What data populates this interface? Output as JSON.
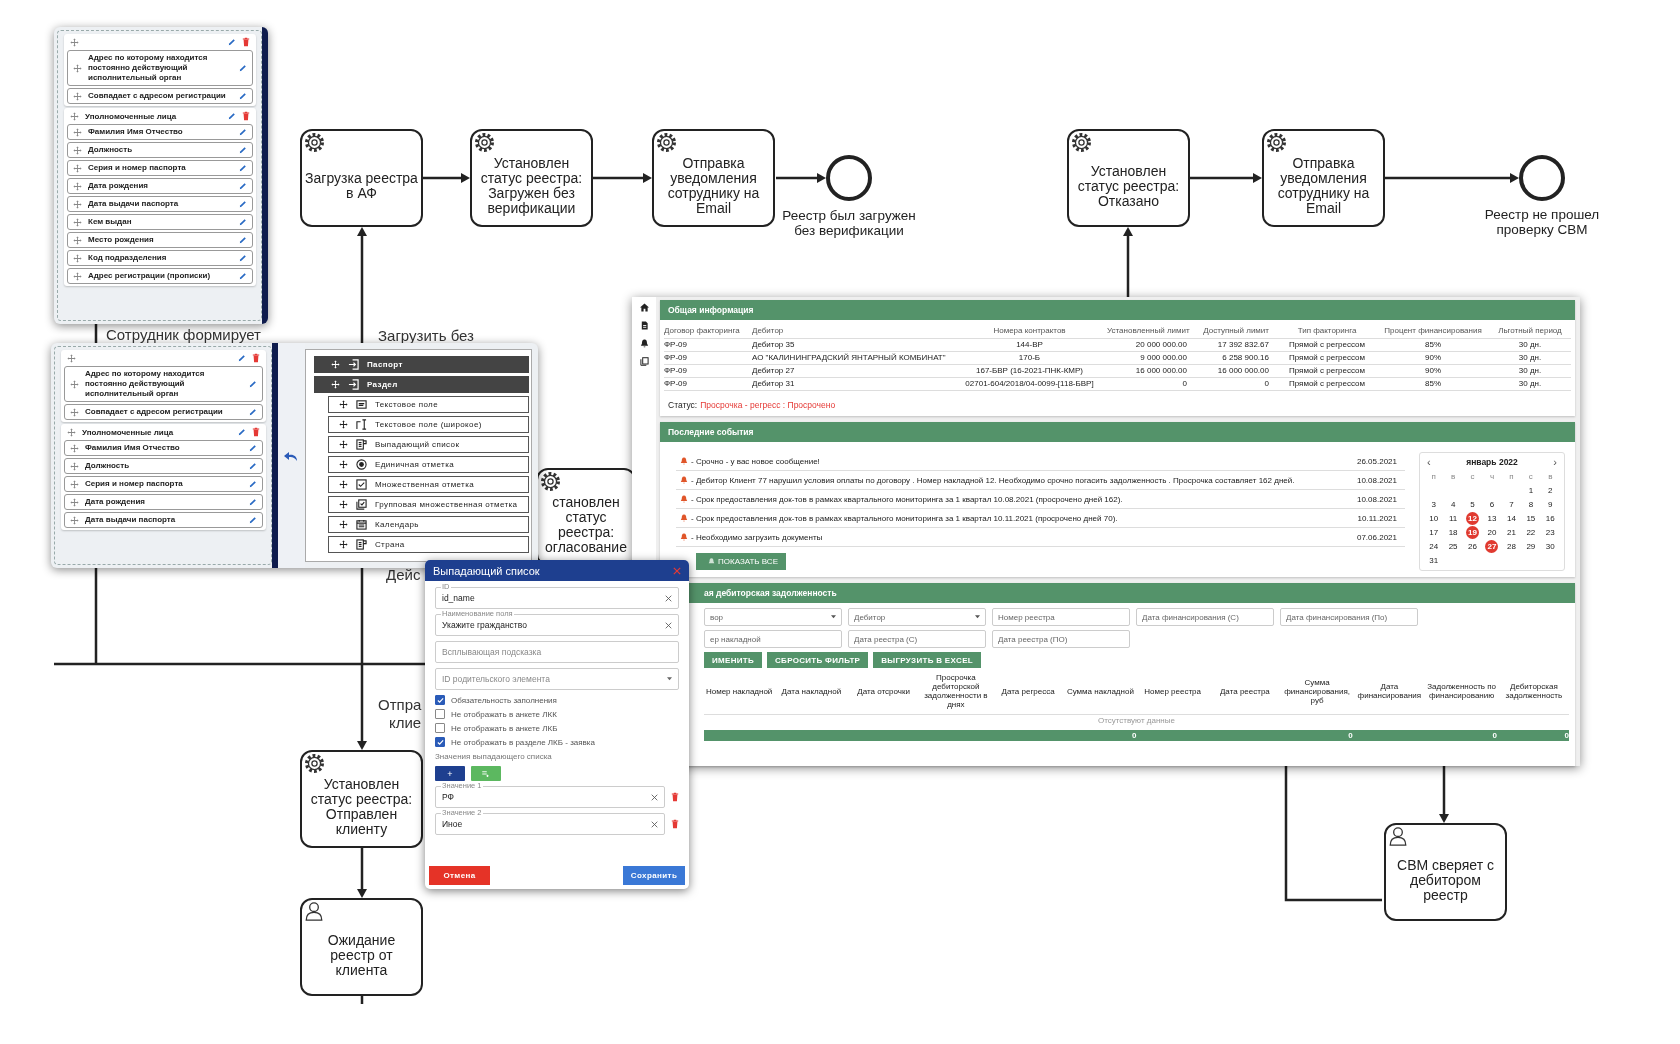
{
  "diagram": {
    "tasks": [
      {
        "kind": "service",
        "label": "Загрузка реестра в АФ"
      },
      {
        "kind": "service",
        "label": "Установлен статус реестра: Загружен без верификации"
      },
      {
        "kind": "service",
        "label": "Отправка уведомления сотруднику на Email"
      },
      {
        "kind": "service",
        "label": "Установлен статус реестра: Отказано"
      },
      {
        "kind": "service",
        "label": "Отправка уведомления сотруднику на Email"
      },
      {
        "kind": "service",
        "label": "становлен статус реестра: огласование"
      },
      {
        "kind": "service",
        "label": "Установлен статус реестра: Отправлен клиенту"
      },
      {
        "kind": "user",
        "label": "Ожидание реестр от клиента"
      },
      {
        "kind": "user",
        "label": "СВМ сверяет с дебитором реестр"
      }
    ],
    "end_events": [
      {
        "label": "Реестр был загружен без верификации"
      },
      {
        "label": "Реестр не прошел проверку СВМ"
      }
    ],
    "flow_labels": [
      "Сотрудник формирует",
      "Загрузить без",
      "Дейс",
      "Отпра",
      "клие"
    ]
  },
  "form_panel": {
    "sections": [
      {
        "fields": [
          "Адрес по которому находится постоянно действующий исполнительный орган",
          "Совпадает с адресом регистрации"
        ]
      },
      {
        "title": "Уполномоченные лица",
        "fields": [
          "Фамилия Имя Отчество",
          "Должность",
          "Серия и номер паспорта",
          "Дата рождения",
          "Дата выдачи паспорта",
          "Кем выдан",
          "Место рождения",
          "Код подразделения",
          "Адрес регистрации (прописки)"
        ]
      }
    ]
  },
  "builder": {
    "form": {
      "sections": [
        {
          "fields": [
            "Адрес по которому находится постоянно действующий исполнительный орган",
            "Совпадает с адресом регистрации"
          ]
        },
        {
          "title": "Уполномоченные лица",
          "fields": [
            "Фамилия Имя Отчество",
            "Должность",
            "Серия и номер паспорта",
            "Дата рождения",
            "Дата выдачи паспорта"
          ]
        }
      ]
    },
    "toolbox": [
      {
        "kind": "group",
        "label": "Паспорт"
      },
      {
        "kind": "group",
        "label": "Раздел"
      },
      {
        "kind": "field",
        "label": "Текстовое поле"
      },
      {
        "kind": "field",
        "label": "Текстовое поле (широкое)"
      },
      {
        "kind": "field",
        "label": "Выпадающий список"
      },
      {
        "kind": "field",
        "label": "Единичная отметка"
      },
      {
        "kind": "field",
        "label": "Множественная отметка"
      },
      {
        "kind": "field",
        "label": "Групповая множественная отметка"
      },
      {
        "kind": "field",
        "label": "Календарь"
      },
      {
        "kind": "field",
        "label": "Страна"
      }
    ]
  },
  "dialog": {
    "title": "Выпадающий список",
    "fields": [
      {
        "kind": "text",
        "label": "ID",
        "value": "id_name"
      },
      {
        "kind": "text",
        "label": "Наименование поля",
        "value": "Укажите гражданство"
      },
      {
        "kind": "text",
        "placeholder": "Всплывающая подсказка"
      },
      {
        "kind": "select",
        "placeholder": "ID родительского элемента"
      }
    ],
    "checkboxes": [
      {
        "label": "Обязательность заполнения",
        "checked": true
      },
      {
        "label": "Не отображать в анкете ЛКК",
        "checked": false
      },
      {
        "label": "Не отображать в анкете ЛКБ",
        "checked": false
      },
      {
        "label": "Не отображать в разделе ЛКБ - заявка",
        "checked": true
      }
    ],
    "values_heading": "Значения выпадающего списка",
    "add_button": "+",
    "values": [
      {
        "label": "Значение 1",
        "value": "РФ"
      },
      {
        "label": "Значение 2",
        "value": "Иное"
      }
    ],
    "cancel": "Отмена",
    "save": "Сохранить"
  },
  "dashboard": {
    "general": {
      "title": "Общая информация",
      "columns": [
        "Договор факторинга",
        "Дебитор",
        "Номера контрактов",
        "Установленный лимит",
        "Доступный лимит",
        "Тип факторинга",
        "Процент финансирования",
        "Льготный период"
      ],
      "rows": [
        [
          "ФР-09",
          "Дебитор 35",
          "144-ВР",
          "20 000 000.00",
          "17 392 832.67",
          "Прямой с регрессом",
          "85%",
          "30 дн."
        ],
        [
          "ФР-09",
          "АО \"КАЛИНИНГРАДСКИЙ ЯНТАРНЫЙ КОМБИНАТ\"",
          "170-Б",
          "9 000 000.00",
          "6 258 900.16",
          "Прямой с регрессом",
          "90%",
          "30 дн."
        ],
        [
          "ФР-09",
          "Дебитор 27",
          "167-БВР (16-2021-ПНК-КМР)",
          "16 000 000.00",
          "16 000 000.00",
          "Прямой с регрессом",
          "90%",
          "30 дн."
        ],
        [
          "ФР-09",
          "Дебитор 31",
          "02701-604/2018/04-0099-[118-БВР]",
          "0",
          "0",
          "Прямой с регрессом",
          "85%",
          "30 дн."
        ]
      ],
      "status_label": "Статус:",
      "status_value": "Просрочка - регресс : Просрочено"
    },
    "events": {
      "title": "Последние события",
      "items": [
        {
          "text": "- Срочно - у вас новое сообщение!",
          "date": "26.05.2021"
        },
        {
          "text": "- Дебитор Клиент 77 нарушил условия оплаты по договору . Номер накладной 12. Необходимо срочно погасить задолженность . Просрочка составляет 162 дней.",
          "date": "10.08.2021"
        },
        {
          "text": "- Срок предоставления док-тов в рамках квартального мониторинга за 1 квартал 10.08.2021 (просрочено дней 162).",
          "date": "10.08.2021"
        },
        {
          "text": "- Срок предоставления док-тов в рамках квартального мониторинга за 1 квартал 10.11.2021 (просрочено дней 70).",
          "date": "10.11.2021"
        },
        {
          "text": "- Необходимо загрузить документы",
          "date": "07.06.2021"
        }
      ],
      "show_all": "ПОКАЗАТЬ ВСЕ",
      "calendar": {
        "prev": "‹",
        "next": "›",
        "month": "январь 2022",
        "weekdays": [
          "п",
          "в",
          "с",
          "ч",
          "п",
          "с",
          "в"
        ],
        "days": [
          {
            "day": "1",
            "marked": false
          },
          {
            "day": "2",
            "marked": false
          },
          {
            "day": "3",
            "marked": false
          },
          {
            "day": "4",
            "marked": false
          },
          {
            "day": "5",
            "marked": false
          },
          {
            "day": "6",
            "marked": false
          },
          {
            "day": "7",
            "marked": false
          },
          {
            "day": "8",
            "marked": false
          },
          {
            "day": "9",
            "marked": false
          },
          {
            "day": "10",
            "marked": false
          },
          {
            "day": "11",
            "marked": false
          },
          {
            "day": "12",
            "marked": true
          },
          {
            "day": "13",
            "marked": false
          },
          {
            "day": "14",
            "marked": false
          },
          {
            "day": "15",
            "marked": false
          },
          {
            "day": "16",
            "marked": false
          },
          {
            "day": "17",
            "marked": false
          },
          {
            "day": "18",
            "marked": false
          },
          {
            "day": "19",
            "marked": true
          },
          {
            "day": "20",
            "marked": false
          },
          {
            "day": "21",
            "marked": false
          },
          {
            "day": "22",
            "marked": false
          },
          {
            "day": "23",
            "marked": false
          },
          {
            "day": "24",
            "marked": false
          },
          {
            "day": "25",
            "marked": false
          },
          {
            "day": "26",
            "marked": false
          },
          {
            "day": "27",
            "marked": true
          },
          {
            "day": "28",
            "marked": false
          },
          {
            "day": "29",
            "marked": false
          },
          {
            "day": "30",
            "marked": false
          },
          {
            "day": "31",
            "marked": false
          }
        ]
      }
    },
    "debt": {
      "title": "ая дебиторская задолженность",
      "filters": [
        {
          "kind": "select",
          "placeholder": "вор"
        },
        {
          "kind": "select",
          "placeholder": "Дебитор"
        },
        {
          "kind": "text",
          "placeholder": "Номер реестра"
        },
        {
          "kind": "text",
          "placeholder": "Дата финансирования (С)"
        },
        {
          "kind": "text",
          "placeholder": "Дата финансирования (По)"
        },
        {
          "kind": "text",
          "placeholder": "ер накладной"
        },
        {
          "kind": "text",
          "placeholder": "Дата реестра (С)"
        },
        {
          "kind": "text",
          "placeholder": "Дата реестра (ПО)"
        }
      ],
      "buttons": [
        "ИМЕНИТЬ",
        "СБРОСИТЬ ФИЛЬТР",
        "ВЫГРУЗИТЬ В EXCEL"
      ],
      "columns": [
        {
          "label": "Номер накладной"
        },
        {
          "label": "Дата накладной"
        },
        {
          "label": "Дата отсрочки"
        },
        {
          "label": "Просрочка дебиторской задолженности в днях"
        },
        {
          "label": "Дата регресса"
        },
        {
          "label": "Сумма накладной",
          "total": "0"
        },
        {
          "label": "Номер реестра"
        },
        {
          "label": "Дата реестра"
        },
        {
          "label": "Сумма финансирования, руб",
          "total": "0"
        },
        {
          "label": "Дата финансирования"
        },
        {
          "label": "Задолженность по финансированию",
          "total": "0"
        },
        {
          "label": "Дебиторская задолженность",
          "total": "0"
        }
      ],
      "empty": "Отсутствуют данные"
    }
  }
}
